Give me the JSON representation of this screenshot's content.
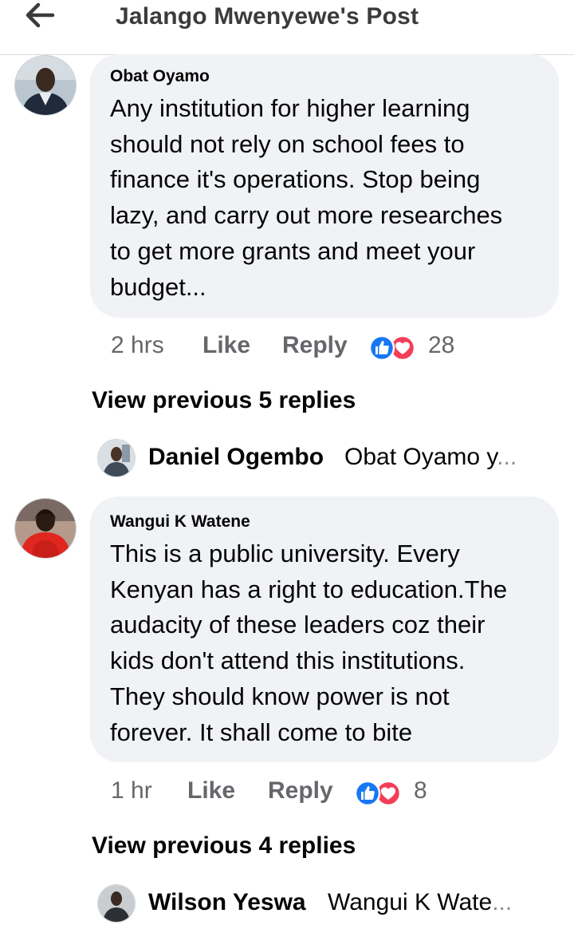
{
  "header": {
    "back_icon": "arrow-left-icon",
    "title": "Jalango Mwenyewe's Post"
  },
  "comments": [
    {
      "author": "Obat Oyamo",
      "text": "Any institution for higher learning should not rely on school fees to finance it's operations. Stop being lazy, and carry out more researches to get more grants and meet your budget...",
      "lines": [
        "Any institution for higher learning",
        "should not rely on school fees to",
        "finance it's operations. Stop being",
        "lazy, and carry out more researches",
        "to get more grants and meet your",
        "budget..."
      ],
      "time": "2 hrs",
      "like_label": "Like",
      "reply_label": "Reply",
      "reactions": [
        "like-icon",
        "love-icon"
      ],
      "reaction_count": "28",
      "view_previous": "View previous 5 replies",
      "latest_reply": {
        "name": "Daniel Ogembo",
        "snippet": "Obat Oyamo y",
        "ellipsis": "..."
      }
    },
    {
      "author": "Wangui K Watene",
      "lines": [
        "This is a public university. Every",
        "Kenyan has a right to education.The",
        "audacity of these leaders coz their",
        "kids don't attend this institutions.",
        "They should know power is not",
        "forever. It shall come to bite"
      ],
      "time": "1 hr",
      "like_label": "Like",
      "reply_label": "Reply",
      "reactions": [
        "like-icon",
        "love-icon"
      ],
      "reaction_count": "8",
      "view_previous": "View previous 4 replies",
      "latest_reply": {
        "name": "Wilson Yeswa",
        "snippet": "Wangui K Wate",
        "ellipsis": "..."
      }
    }
  ],
  "colors": {
    "bubble_bg": "#f0f2f5",
    "meta_text": "#65676b",
    "like_blue": "#1877f2",
    "love_red": "#f33e58"
  }
}
